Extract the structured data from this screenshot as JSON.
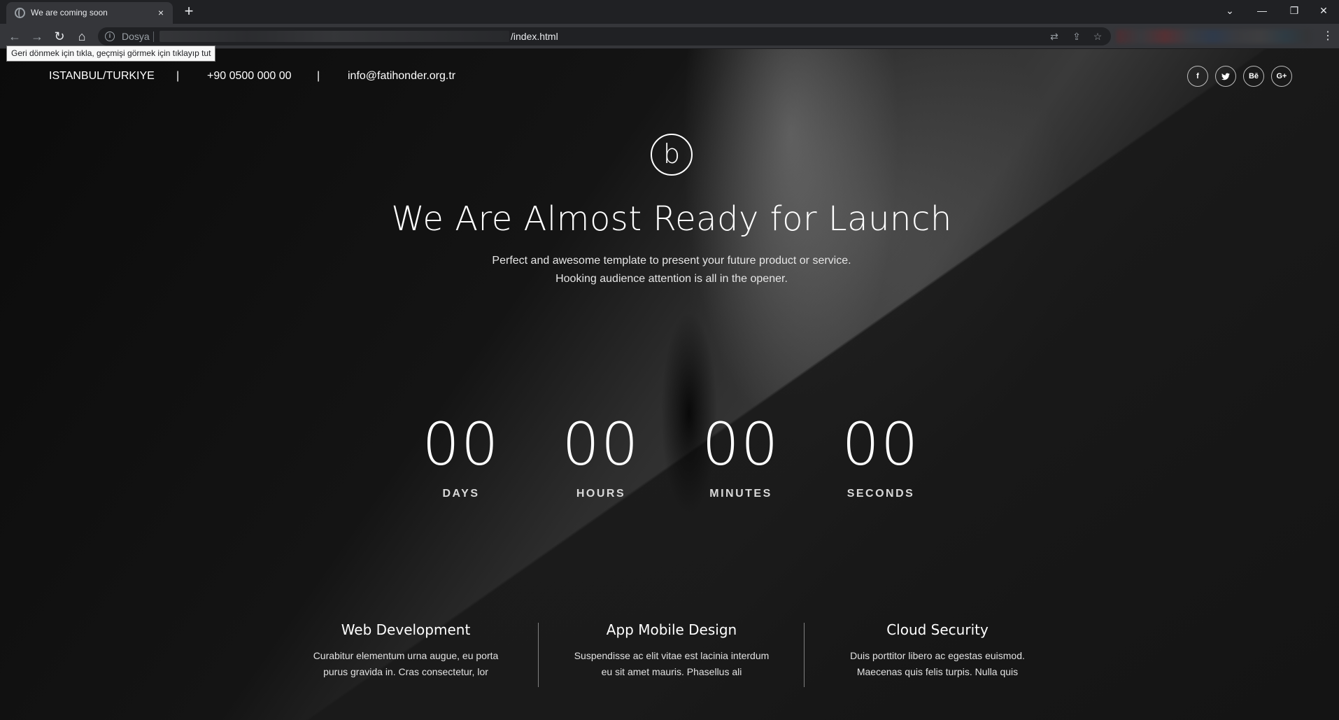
{
  "browser": {
    "tab_title": "We are coming soon",
    "tab_close": "×",
    "new_tab": "+",
    "window": {
      "dropdown": "⌄",
      "minimize": "—",
      "restore": "❐",
      "close": "✕"
    },
    "nav": {
      "back": "←",
      "forward": "→",
      "reload": "↻",
      "home": "⌂"
    },
    "security_label": "Dosya",
    "url_visible": "/index.html",
    "tooltip": "Geri dönmek için tıkla, geçmişi görmek için tıklayıp tut",
    "icons": [
      "translate-icon",
      "share-icon",
      "bookmark-star-icon",
      "menu-icon"
    ]
  },
  "topbar": {
    "location": "ISTANBUL/TURKIYE",
    "separator": "|",
    "phone": "+90 0500 000 00",
    "email": "info@fatihonder.org.tr",
    "social": [
      {
        "name": "facebook-icon",
        "label": "f"
      },
      {
        "name": "twitter-icon",
        "label": "🐦"
      },
      {
        "name": "behance-icon",
        "label": "Bē"
      },
      {
        "name": "google-plus-icon",
        "label": "G+"
      }
    ]
  },
  "hero": {
    "logo_letter": "b",
    "headline": "We Are Almost Ready for Launch",
    "sub_line1": "Perfect and awesome template to present your future product or service.",
    "sub_line2": "Hooking audience attention is all in the opener."
  },
  "countdown": {
    "days": "00",
    "days_label": "DAYS",
    "hours": "00",
    "hours_label": "HOURS",
    "minutes": "00",
    "minutes_label": "MINUTES",
    "seconds": "00",
    "seconds_label": "SECONDS"
  },
  "features": [
    {
      "title": "Web Development",
      "text": "Curabitur elementum urna augue, eu porta purus gravida in. Cras consectetur, lor"
    },
    {
      "title": "App Mobile Design",
      "text": "Suspendisse ac elit vitae est lacinia interdum eu sit amet mauris. Phasellus ali"
    },
    {
      "title": "Cloud Security",
      "text": "Duis porttitor libero ac egestas euismod. Maecenas quis felis turpis. Nulla quis"
    }
  ],
  "colors": {
    "background": "#121212",
    "text": "#ffffff",
    "chrome": "#35363a"
  }
}
